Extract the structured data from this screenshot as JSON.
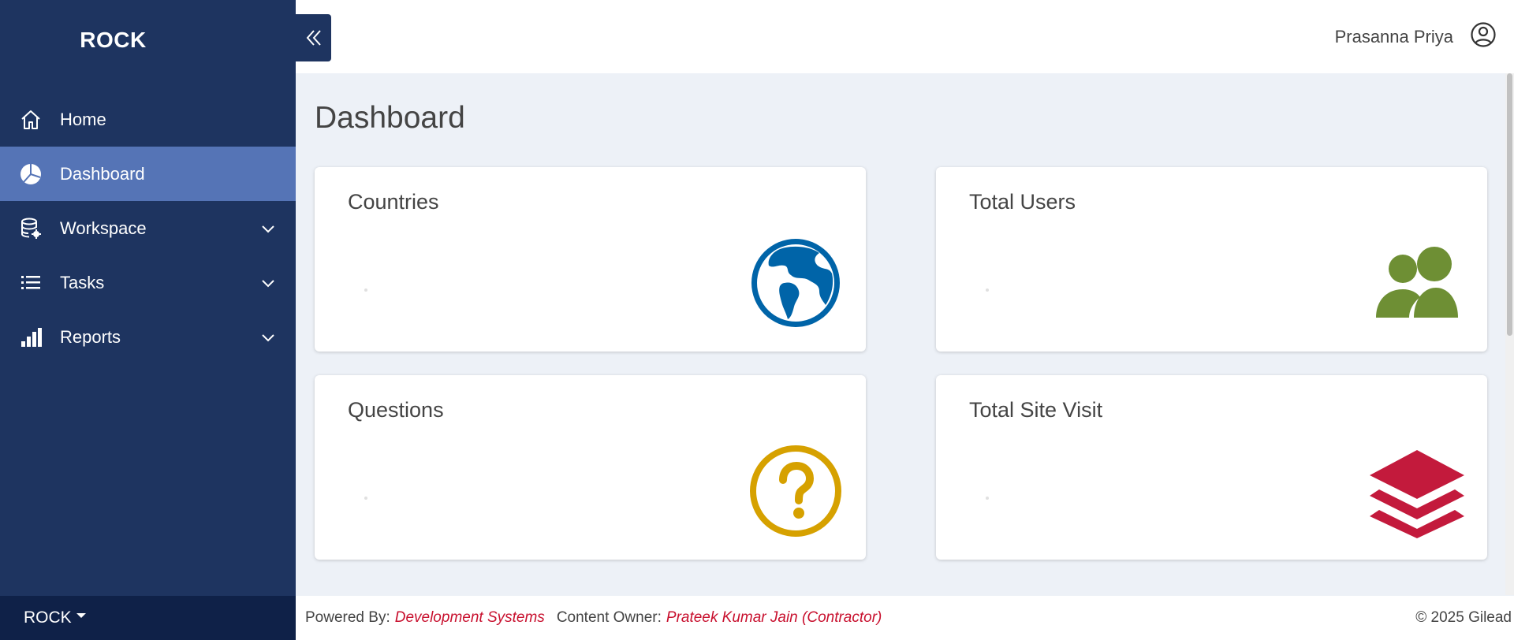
{
  "brand": "ROCK",
  "sidebar": {
    "items": [
      {
        "label": "Home",
        "icon": "home-icon"
      },
      {
        "label": "Dashboard",
        "icon": "pie-chart-icon",
        "active": true
      },
      {
        "label": "Workspace",
        "icon": "database-gear-icon",
        "expandable": true
      },
      {
        "label": "Tasks",
        "icon": "list-icon",
        "expandable": true
      },
      {
        "label": "Reports",
        "icon": "bar-chart-icon",
        "expandable": true
      }
    ],
    "footer_label": "ROCK"
  },
  "header": {
    "username": "Prasanna Priya",
    "user_icon": "user-circle-icon",
    "collapse_icon": "double-chevron-left-icon"
  },
  "main": {
    "title": "Dashboard",
    "cards": [
      {
        "title": "Countries",
        "icon": "globe-americas-icon",
        "color": "#0064a8"
      },
      {
        "title": "Total Users",
        "icon": "users-icon",
        "color": "#6e8f34"
      },
      {
        "title": "Questions",
        "icon": "question-circle-icon",
        "color": "#d6a100"
      },
      {
        "title": "Total Site Visit",
        "icon": "layers-icon",
        "color": "#c31a3c"
      }
    ]
  },
  "footer": {
    "powered_label": "Powered By:",
    "powered_value": "Development Systems",
    "owner_label": "Content Owner:",
    "owner_value": "Prateek Kumar Jain (Contractor)",
    "copyright": "© 2025 Gilead"
  },
  "colors": {
    "sidebar_bg": "#1e3460",
    "sidebar_active": "#5574b6",
    "sidebar_footer_bg": "#0f2148",
    "main_bg": "#edf1f7",
    "footer_accent": "#c8102e"
  }
}
